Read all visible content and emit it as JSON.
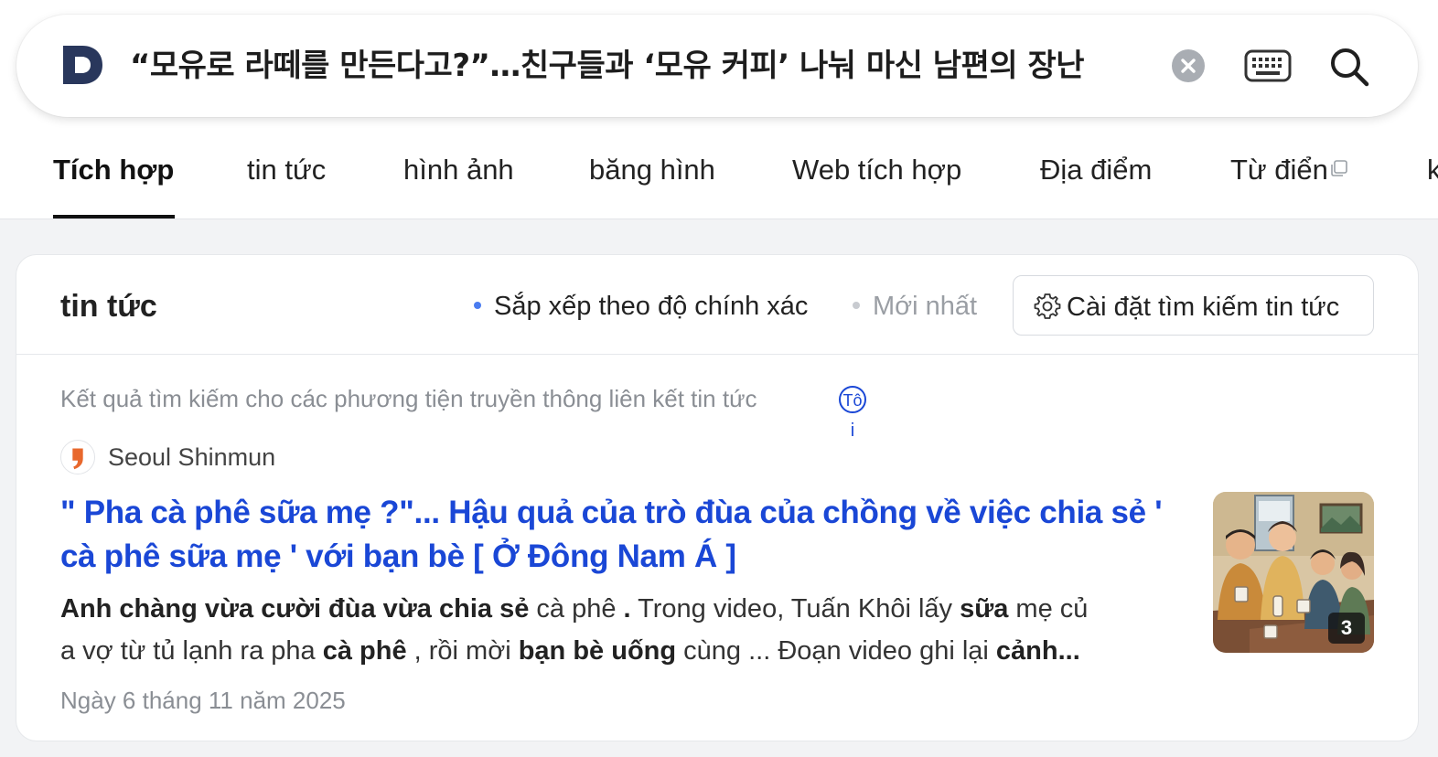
{
  "search": {
    "query": "“모유로 라떼를 만든다고?”…친구들과 ‘모유 커피’ 나눠 마신 남편의 장난",
    "logo_letter": "D"
  },
  "icons": {
    "logo": "daum-d-logo",
    "clear": "clear-x-icon",
    "keyboard": "keyboard-icon",
    "search": "magnifier-icon",
    "external": "new-window-icon",
    "gear": "gear-icon",
    "info": "info-icon"
  },
  "tabs": [
    {
      "label": "Tích hợp",
      "active": true
    },
    {
      "label": "tin tức"
    },
    {
      "label": "hình ảnh"
    },
    {
      "label": "băng hình"
    },
    {
      "label": "Web tích hợp"
    },
    {
      "label": "Địa điểm"
    },
    {
      "label": "Từ điển"
    },
    {
      "label": "k"
    }
  ],
  "news": {
    "section_title": "tin tức",
    "sort_accuracy": "Sắp xếp theo độ chính xác",
    "sort_latest": "Mới nhất",
    "settings_label": "Cài đặt tìm kiếm tin tức",
    "notice": "Kết quả tìm kiếm cho các phương tiện truyền thông liên kết tin tức",
    "info_label_top": "Tô",
    "info_label_bottom": "i",
    "item": {
      "source": "Seoul Shinmun",
      "headline_1": "\" Pha cà phê sữa mẹ ?\"... Hậu quả của trò đùa của chồng về việc chia sẻ '",
      "headline_2": "cà phê sữa mẹ ' với bạn bè [ Ở Đông Nam Á ]",
      "snippet": {
        "s1": "Anh chàng vừa cười đùa vừa chia sẻ",
        "s2": " cà phê ",
        "s3": ".",
        "s4": " Trong video, Tuấn Khôi lấy ",
        "s5": "sữa",
        "s6": " mẹ củ",
        "s7": "a vợ từ tủ lạnh ra pha ",
        "s8": "cà phê",
        "s9": " , rồi mời ",
        "s10": "bạn bè uống",
        "s11": " cùng ... Đoạn video ghi lại ",
        "s12": "cảnh..."
      },
      "date": "Ngày 6 tháng 11 năm 2025",
      "image_count": "3"
    }
  },
  "colors": {
    "accent_blue": "#1a47d6",
    "dot_blue": "#4a7cf0",
    "page_bg": "#f2f3f5",
    "logo_navy": "#29375c"
  }
}
